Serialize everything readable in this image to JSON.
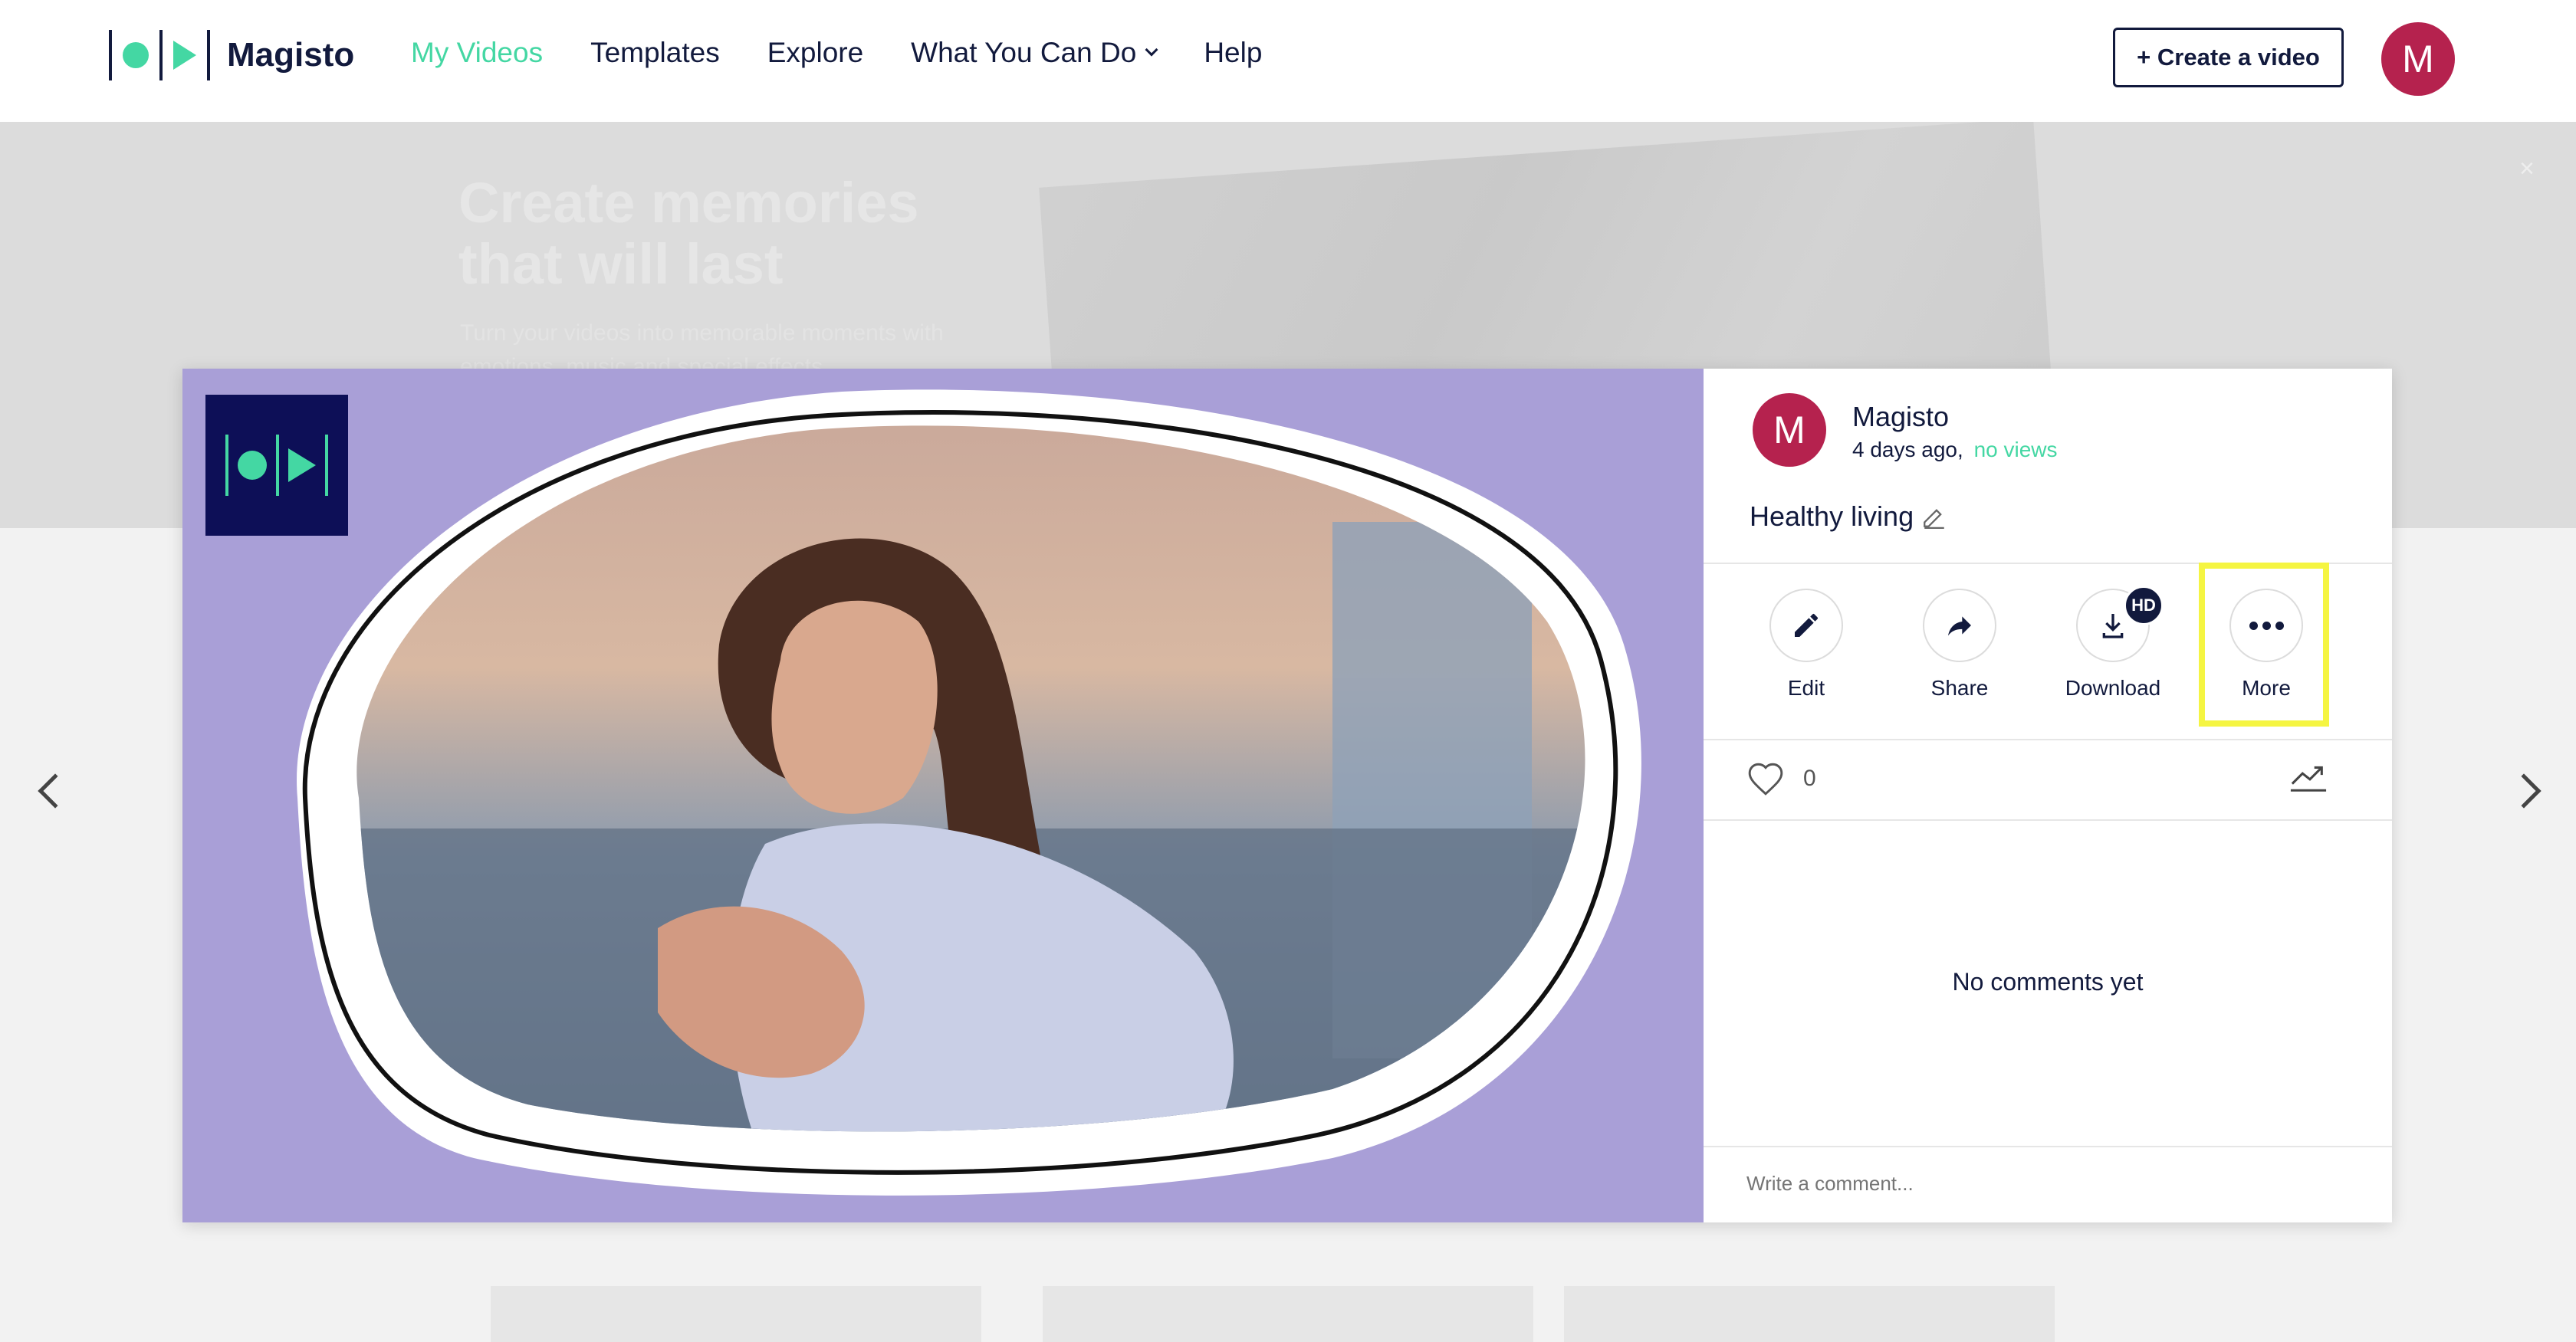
{
  "nav": {
    "brand": "Magisto",
    "links": [
      "My Videos",
      "Templates",
      "Explore",
      "What You Can Do",
      "Help"
    ],
    "create_button": "+ Create a video",
    "avatar_initial": "M"
  },
  "banner": {
    "title_line1": "Create memories",
    "title_line2": "that will last",
    "subtitle": "Turn your videos into memorable moments with emotions, music and special effects",
    "close_icon": "×"
  },
  "video": {
    "background_color": "#a99fd7",
    "logo_bg": "#0d0f57"
  },
  "panel": {
    "avatar_initial": "M",
    "author": "Magisto",
    "time_ago": "4 days ago,",
    "views": "no views",
    "title": "Healthy living",
    "actions": [
      {
        "label": "Edit",
        "icon": "pencil-icon"
      },
      {
        "label": "Share",
        "icon": "share-arrow-icon"
      },
      {
        "label": "Download",
        "icon": "download-icon",
        "badge": "HD"
      },
      {
        "label": "More",
        "icon": "more-dots-icon"
      }
    ],
    "likes_count": "0",
    "no_comments": "No comments yet",
    "comment_placeholder": "Write a comment..."
  },
  "colors": {
    "accent": "#44d7a3",
    "navy": "#121a3d",
    "avatar": "#b5224e",
    "highlight": "#f5f542"
  }
}
